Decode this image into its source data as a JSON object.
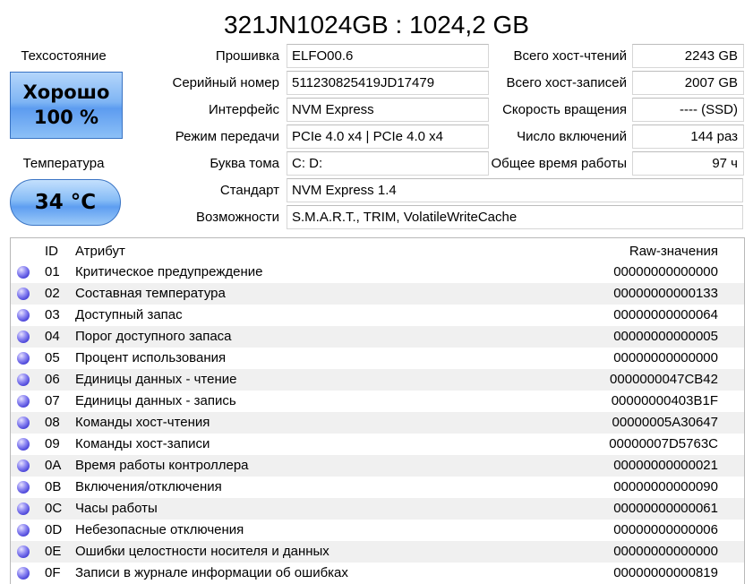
{
  "title": "321JN1024GB : 1024,2 GB",
  "health": {
    "label": "Техсостояние",
    "status": "Хорошо",
    "percent": "100 %",
    "color": "#6aa6f2"
  },
  "temperature": {
    "label": "Температура",
    "value": "34 °C"
  },
  "info_left": [
    {
      "label": "Прошивка",
      "value": "ELFO00.6"
    },
    {
      "label": "Серийный номер",
      "value": "511230825419JD17479"
    },
    {
      "label": "Интерфейс",
      "value": "NVM Express"
    },
    {
      "label": "Режим передачи",
      "value": "PCIe 4.0 x4 | PCIe 4.0 x4"
    },
    {
      "label": "Буква тома",
      "value": "C: D:"
    },
    {
      "label": "Стандарт",
      "value": "NVM Express 1.4"
    },
    {
      "label": "Возможности",
      "value": "S.M.A.R.T., TRIM, VolatileWriteCache"
    }
  ],
  "info_right": [
    {
      "label": "Всего хост-чтений",
      "value": "2243 GB"
    },
    {
      "label": "Всего хост-записей",
      "value": "2007 GB"
    },
    {
      "label": "Скорость вращения",
      "value": "---- (SSD)"
    },
    {
      "label": "Число включений",
      "value": "144 раз"
    },
    {
      "label": "Общее время работы",
      "value": "97 ч"
    }
  ],
  "table": {
    "headers": {
      "id": "ID",
      "attribute": "Атрибут",
      "raw": "Raw-значения"
    },
    "rows": [
      {
        "id": "01",
        "attribute": "Критическое предупреждение",
        "raw": "00000000000000"
      },
      {
        "id": "02",
        "attribute": "Составная температура",
        "raw": "00000000000133"
      },
      {
        "id": "03",
        "attribute": "Доступный запас",
        "raw": "00000000000064"
      },
      {
        "id": "04",
        "attribute": "Порог доступного запаса",
        "raw": "00000000000005"
      },
      {
        "id": "05",
        "attribute": "Процент использования",
        "raw": "00000000000000"
      },
      {
        "id": "06",
        "attribute": "Единицы данных - чтение",
        "raw": "0000000047CB42"
      },
      {
        "id": "07",
        "attribute": "Единицы данных - запись",
        "raw": "00000000403B1F"
      },
      {
        "id": "08",
        "attribute": "Команды хост-чтения",
        "raw": "00000005A30647"
      },
      {
        "id": "09",
        "attribute": "Команды хост-записи",
        "raw": "00000007D5763C"
      },
      {
        "id": "0A",
        "attribute": "Время работы контроллера",
        "raw": "00000000000021"
      },
      {
        "id": "0B",
        "attribute": "Включения/отключения",
        "raw": "00000000000090"
      },
      {
        "id": "0C",
        "attribute": "Часы работы",
        "raw": "00000000000061"
      },
      {
        "id": "0D",
        "attribute": "Небезопасные отключения",
        "raw": "00000000000006"
      },
      {
        "id": "0E",
        "attribute": "Ошибки целостности носителя и данных",
        "raw": "00000000000000"
      },
      {
        "id": "0F",
        "attribute": "Записи в журнале информации об ошибках",
        "raw": "00000000000819"
      }
    ]
  }
}
